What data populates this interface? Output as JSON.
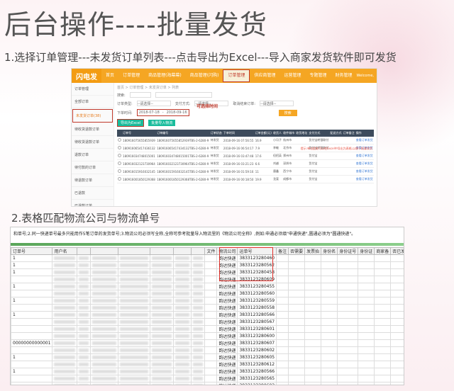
{
  "title": "后台操作----批量发货",
  "step1": "1.选择订单管理---未发货订单列表---点击导出为Excel---导入商家发货软件即可发货",
  "step2": "2.表格匹配物流公司与物流单号",
  "app": {
    "logo": "闪电发",
    "nav": [
      "首页",
      "订单管理",
      "商品管理(海幕幕)",
      "商品管理(闪购)",
      "订单管理",
      "供应商管理",
      "运营管理",
      "专题管理",
      "财务管理"
    ],
    "welcome": "Welcome,"
  },
  "sidebar": [
    "订单管理",
    "全部订单",
    "未发货订单(38)",
    "待收货退款订单",
    "待收货退款订单",
    "退款订单",
    "待付款的订单",
    "待退款订单",
    "已退款",
    "已退款订单"
  ],
  "breadcrumb": "首页 > 订单管理 > 未发货订单 > 列表",
  "filters": {
    "search_label": "搜索:",
    "order_status": "订单类型:",
    "pay_method": "支付方式:",
    "cancel_reason": "取消结束订单:",
    "select_ph": "--请选择--",
    "time_label": "下单时间:",
    "date_from": "2018-07-18",
    "date_to": "2018-09-16",
    "time_hint": "可选择时间",
    "search_btn": "搜索",
    "export_btn": "导出为Excel",
    "import_btn": "批量导入物流",
    "note": "提示:单击此处可以在Excel中导出为表格,以便于批量发货"
  },
  "table1": {
    "headers": [
      "",
      "订单号",
      "订单编号",
      "订单状态",
      "下单时间",
      "订单金额(元)",
      "收货人",
      "收件城市",
      "收货地址",
      "支付方式",
      "配送方式",
      "订单备注",
      "操作"
    ],
    "rows": [
      [
        "180916075655855939",
        "180916075655852939TBS-2-6280-9",
        "待发货",
        "2018-09-16 07:56:55",
        "16.9",
        "小冯子",
        "杭州市",
        "",
        "货付宝转银联付",
        "",
        "",
        "查看订单发货"
      ],
      [
        "180916065417436132",
        "180916065417434132TBS-2-6280-9",
        "待发货",
        "2018-09-16 06:54:17",
        "7.9",
        "李敏",
        "北京市",
        "",
        "货付宝转银联付",
        "",
        "",
        "查看订单发货"
      ],
      [
        "180916034748015001",
        "180916034748015001TBS-2-6280-9",
        "待发货",
        "2018-09-16 03:47:48",
        "17.6",
        "但招英",
        "郑州市",
        "",
        "货付宝",
        "",
        "",
        "查看订单发货"
      ],
      [
        "180916032123730964",
        "180916032123730964TBS-2-6280-9",
        "待发货",
        "2018-09-16 03:21:23",
        "6.6",
        "刘越",
        "深圳市",
        "",
        "货付宝",
        "",
        "",
        "查看订单发货"
      ],
      [
        "180916015916032145",
        "180916015916032145TBS-2-6280-9",
        "待发货",
        "2018-09-16 01:59:16",
        "11",
        "唐鑫",
        "西宁市",
        "",
        "货付宝",
        "",
        "",
        "查看订单发货"
      ],
      [
        "180916001850129368",
        "180916001850129368TBS-2-6280-9",
        "待发货",
        "2018-09-16 00:18:50",
        "19.9",
        "龙斐",
        "成都市",
        "",
        "货付宝",
        "",
        "",
        "查看订单发货"
      ]
    ]
  },
  "sheet": {
    "note": "和单号;2.同一快递单号最多只能用作5笔订单的发货单号;3.物流公司必须写全称,全称可参考批量导入物流里的《物流公司全称》,例如:申通必须填\"申通快递\",圆通必须为\"圆通快递\"。",
    "headers": [
      "订单号",
      "用户名",
      "",
      "",
      "",
      "",
      "",
      "",
      "文件",
      "物流公司",
      "运单号",
      "备注",
      "否需要",
      "发票抬",
      "身份名",
      "身份证号",
      "身份证",
      "商家备",
      "否已发"
    ],
    "courier": "韵达快递",
    "tracking": [
      "3833123280460",
      "3833123280562",
      "3833123280458",
      "3833123280609",
      "3833123280455",
      "3833123280560",
      "3833123280559",
      "3833123280558",
      "3833123280566",
      "3833123280567",
      "3833123280601",
      "3833123280600",
      "3833123280607",
      "3833123280602",
      "3833123280605",
      "3833123280612",
      "3833123280566",
      "3833123280565",
      "3833123280603",
      "3833123280608"
    ],
    "order_prefix": [
      "1",
      "1",
      "1",
      "",
      "1",
      "",
      "1",
      "",
      "1",
      "",
      "",
      "",
      "00000000000001",
      "",
      "1",
      "",
      "1",
      "",
      "",
      "00000000000"
    ]
  }
}
